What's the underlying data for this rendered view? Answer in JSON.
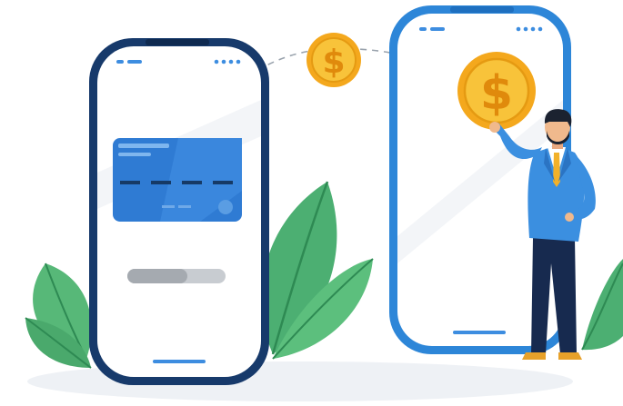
{
  "illustration": {
    "coin_symbol": "$",
    "colors": {
      "phone_left_frame": "#173a6b",
      "phone_right_frame": "#2d86d8",
      "card": "#2f7bd3",
      "coin": "#f6b928",
      "leaves": "#4caf72",
      "suit": "#3b8fe0",
      "trousers": "#172a4f"
    }
  }
}
